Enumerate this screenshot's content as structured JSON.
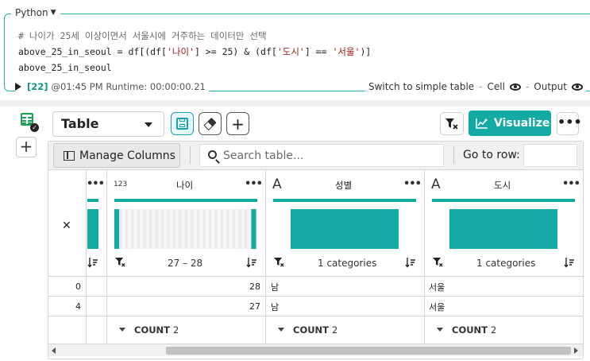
{
  "cell": {
    "language": "Python",
    "code_comment": "# 나이가 25세 이상이면서 서울시에 거주하는 데이터만 선택",
    "code_line2_pre": "above_25_in_seoul = df[(df[",
    "code_line2_str1": "'나이'",
    "code_line2_mid": "] >= 25) & (df[",
    "code_line2_str2": "'도시'",
    "code_line2_mid2": "] == ",
    "code_line2_str3": "'서울'",
    "code_line2_post": ")]",
    "code_line3": "above_25_in_seoul",
    "exec_count": "[22]",
    "run_meta": "@01:45 PM Runtime: 00:00:00.21",
    "switch_label": "Switch to simple table",
    "cell_label": "Cell",
    "output_label": "Output"
  },
  "toolbar": {
    "view_select": "Table",
    "visualize_label": "Visualize",
    "more": "•••"
  },
  "grid_toolbar": {
    "manage_columns": "Manage Columns",
    "search_placeholder": "Search table...",
    "goto_label": "Go to row:"
  },
  "columns": [
    {
      "name": "나이",
      "type_tag": "123",
      "summary": "27 – 28"
    },
    {
      "name": "성별",
      "type_tag": "A",
      "summary": "1 categories"
    },
    {
      "name": "도시",
      "type_tag": "A",
      "summary": "1 categories"
    }
  ],
  "rows": [
    {
      "index": "0",
      "나이": "28",
      "성별": "남",
      "도시": "서울"
    },
    {
      "index": "4",
      "나이": "27",
      "성별": "남",
      "도시": "서울"
    }
  ],
  "footer": {
    "count_word": "COUNT",
    "counts": [
      "2",
      "2",
      "2"
    ]
  },
  "colors": {
    "accent": "#13aaa4",
    "cell_border": "#2ab3a6",
    "exec_count": "#0f9488"
  }
}
